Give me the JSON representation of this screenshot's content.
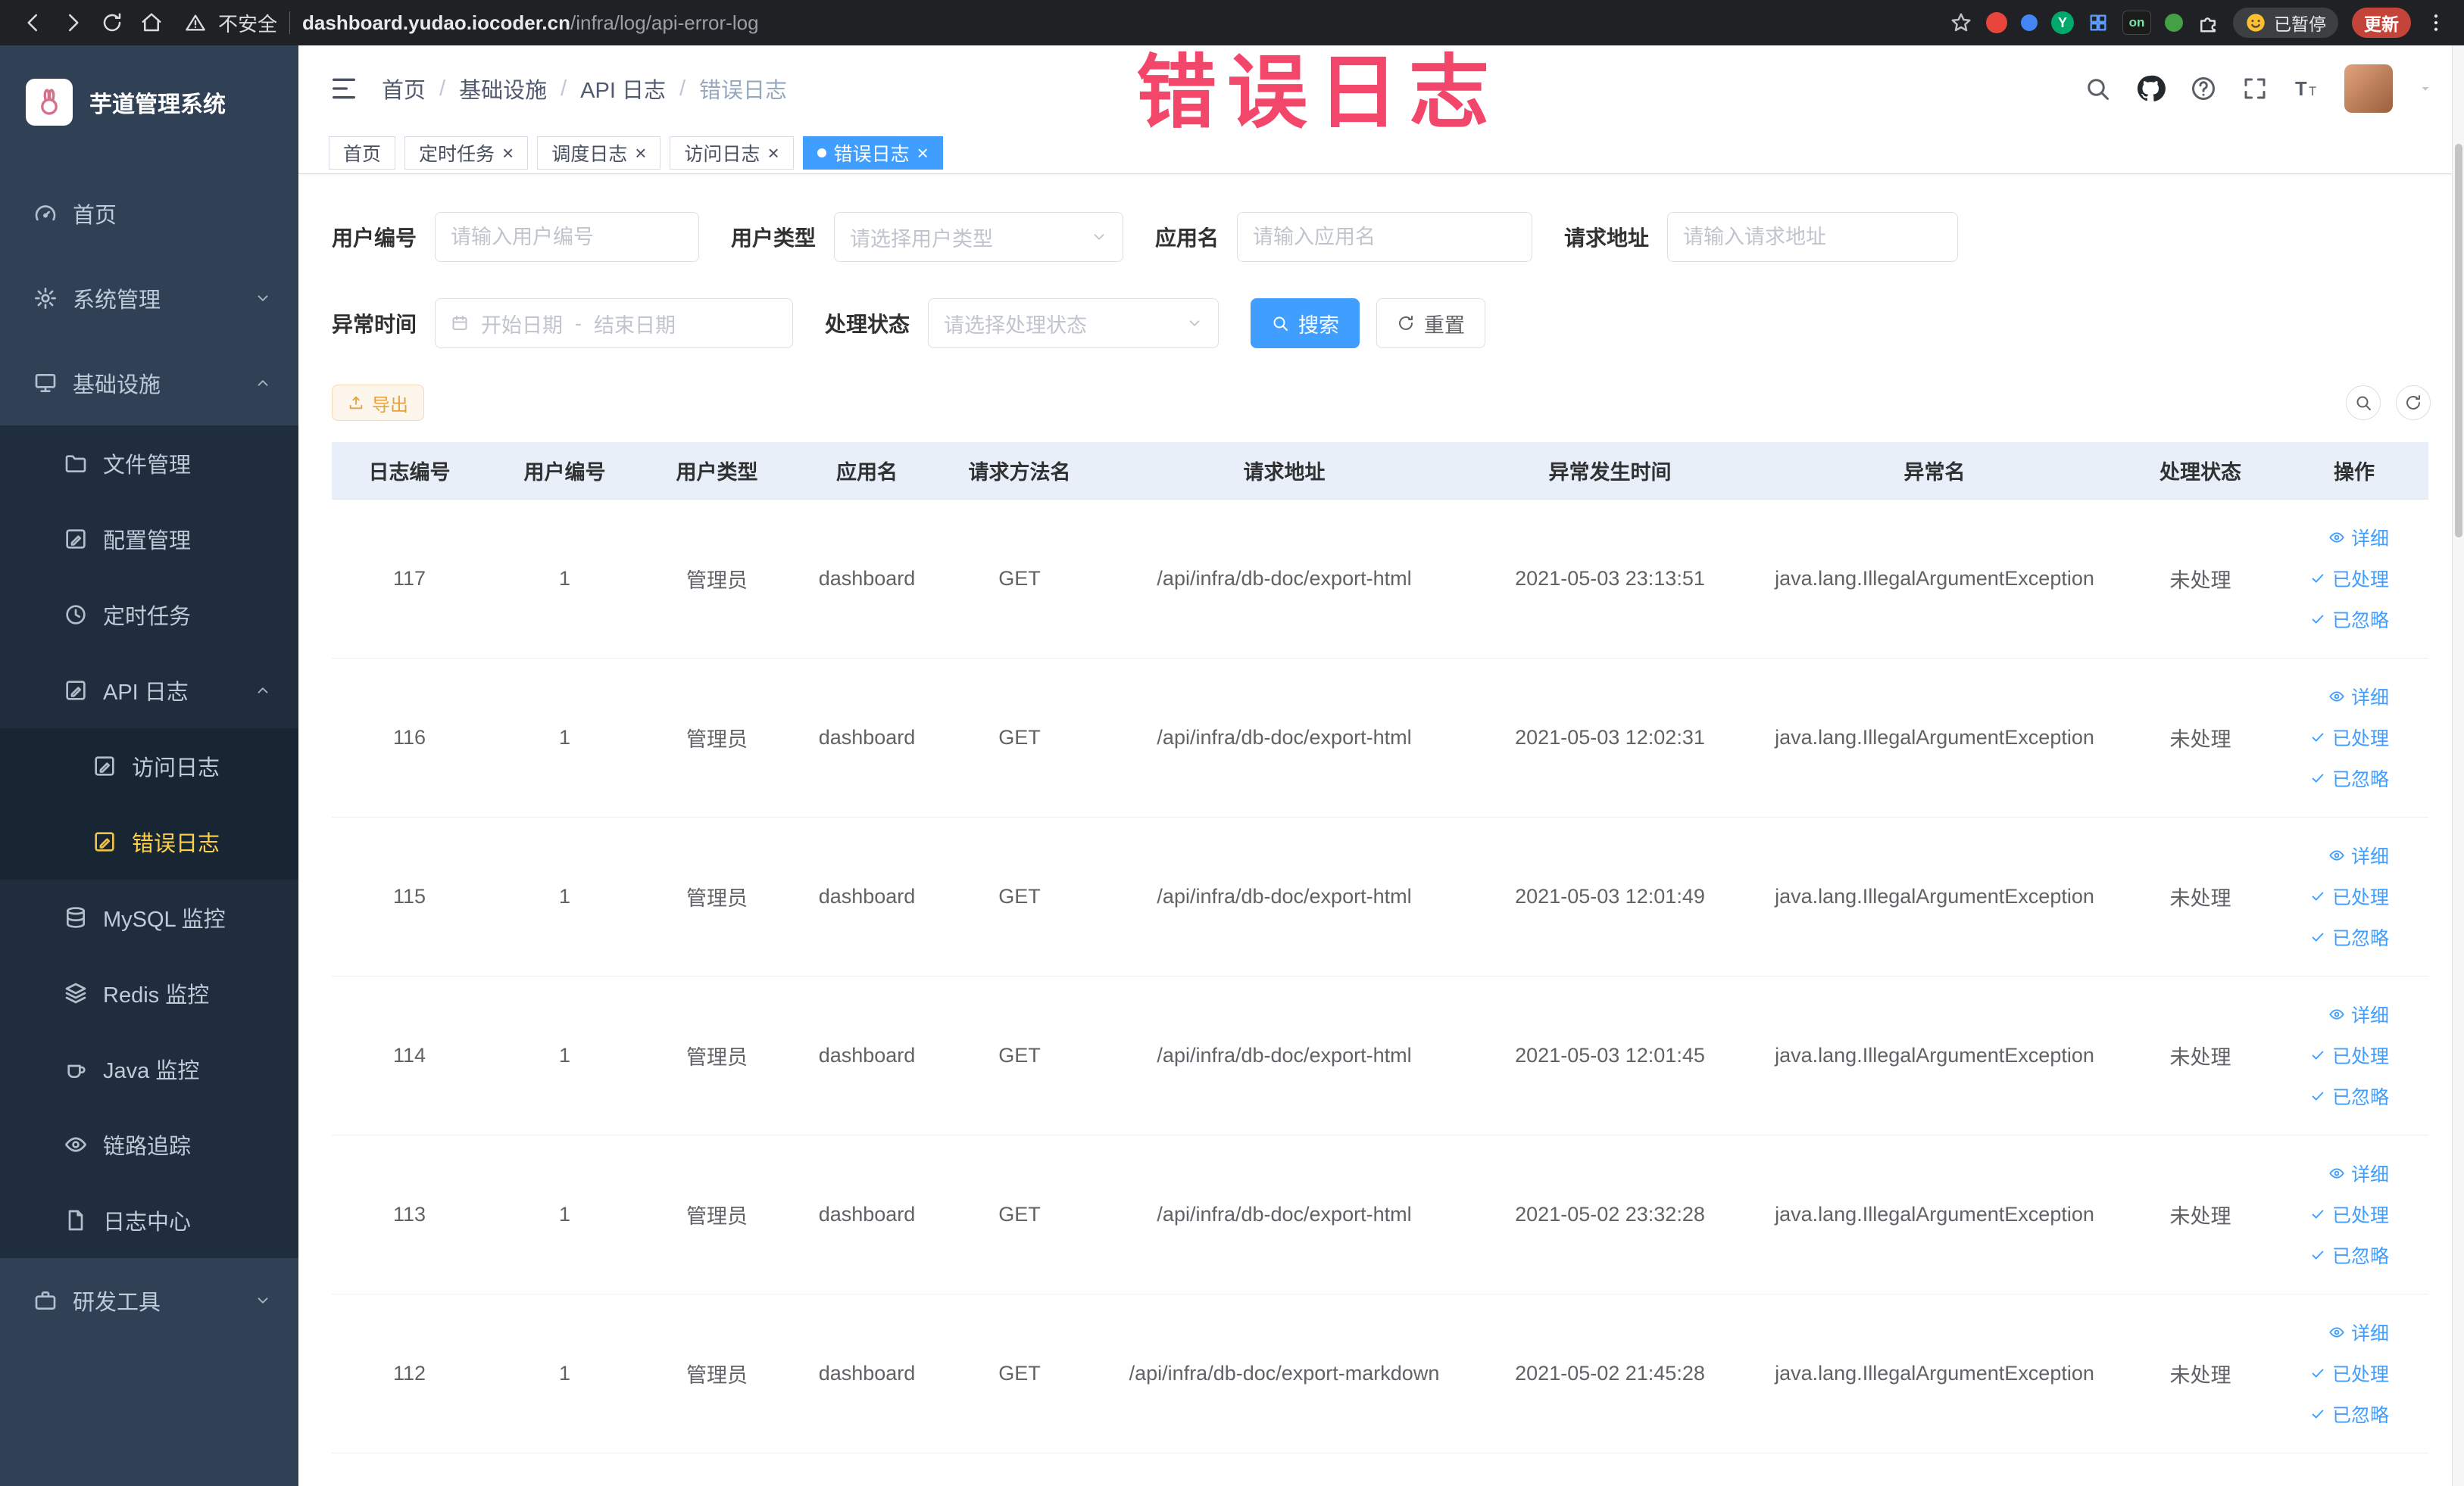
{
  "browser": {
    "security_label": "不安全",
    "url_domain": "dashboard.yudao.iocoder.cn",
    "url_path": "/infra/log/api-error-log",
    "extension_on_badge": "on",
    "paused_label": "已暂停",
    "update_label": "更新"
  },
  "annotation": {
    "text": "错误日志",
    "color": "#f2466b"
  },
  "sidebar": {
    "app_title": "芋道管理系统",
    "items": [
      {
        "key": "home",
        "label": "首页",
        "level": 1,
        "icon": "gauge"
      },
      {
        "key": "system",
        "label": "系统管理",
        "level": 1,
        "icon": "gear",
        "arrow": "down"
      },
      {
        "key": "infra",
        "label": "基础设施",
        "level": 1,
        "icon": "infra",
        "arrow": "up"
      },
      {
        "key": "file",
        "label": "文件管理",
        "level": 2,
        "icon": "folder"
      },
      {
        "key": "config",
        "label": "配置管理",
        "level": 2,
        "icon": "edit"
      },
      {
        "key": "job",
        "label": "定时任务",
        "level": 2,
        "icon": "clock"
      },
      {
        "key": "api-log",
        "label": "API 日志",
        "level": 2,
        "icon": "edit",
        "arrow": "up"
      },
      {
        "key": "access-log",
        "label": "访问日志",
        "level": 3,
        "icon": "edit"
      },
      {
        "key": "error-log",
        "label": "错误日志",
        "level": 3,
        "icon": "edit",
        "active": true
      },
      {
        "key": "mysql",
        "label": "MySQL 监控",
        "level": 2,
        "icon": "db"
      },
      {
        "key": "redis",
        "label": "Redis 监控",
        "level": 2,
        "icon": "layers"
      },
      {
        "key": "java",
        "label": "Java 监控",
        "level": 2,
        "icon": "coffee"
      },
      {
        "key": "trace",
        "label": "链路追踪",
        "level": 2,
        "icon": "eye"
      },
      {
        "key": "log-center",
        "label": "日志中心",
        "level": 2,
        "icon": "doc"
      },
      {
        "key": "dev-tools",
        "label": "研发工具",
        "level": 1,
        "icon": "tools",
        "arrow": "down"
      }
    ]
  },
  "header": {
    "breadcrumb": [
      "首页",
      "基础设施",
      "API 日志",
      "错误日志"
    ]
  },
  "tabs": [
    {
      "label": "首页",
      "closable": false,
      "active": false
    },
    {
      "label": "定时任务",
      "closable": true,
      "active": false
    },
    {
      "label": "调度日志",
      "closable": true,
      "active": false
    },
    {
      "label": "访问日志",
      "closable": true,
      "active": false
    },
    {
      "label": "错误日志",
      "closable": true,
      "active": true
    }
  ],
  "filters": {
    "user_id_label": "用户编号",
    "user_id_placeholder": "请输入用户编号",
    "user_type_label": "用户类型",
    "user_type_placeholder": "请选择用户类型",
    "app_name_label": "应用名",
    "app_name_placeholder": "请输入应用名",
    "request_url_label": "请求地址",
    "request_url_placeholder": "请输入请求地址",
    "exception_time_label": "异常时间",
    "start_placeholder": "开始日期",
    "range_separator": "-",
    "end_placeholder": "结束日期",
    "process_status_label": "处理状态",
    "process_status_placeholder": "请选择处理状态",
    "search_label": "搜索",
    "reset_label": "重置"
  },
  "toolbar": {
    "export_label": "导出"
  },
  "table": {
    "columns": [
      "日志编号",
      "用户编号",
      "用户类型",
      "应用名",
      "请求方法名",
      "请求地址",
      "异常发生时间",
      "异常名",
      "处理状态",
      "操作"
    ],
    "rows": [
      {
        "id": "117",
        "user_id": "1",
        "user_type": "管理员",
        "app": "dashboard",
        "method": "GET",
        "url": "/api/infra/db-doc/export-html",
        "time": "2021-05-03 23:13:51",
        "exception": "java.lang.IllegalArgumentException",
        "status": "未处理"
      },
      {
        "id": "116",
        "user_id": "1",
        "user_type": "管理员",
        "app": "dashboard",
        "method": "GET",
        "url": "/api/infra/db-doc/export-html",
        "time": "2021-05-03 12:02:31",
        "exception": "java.lang.IllegalArgumentException",
        "status": "未处理"
      },
      {
        "id": "115",
        "user_id": "1",
        "user_type": "管理员",
        "app": "dashboard",
        "method": "GET",
        "url": "/api/infra/db-doc/export-html",
        "time": "2021-05-03 12:01:49",
        "exception": "java.lang.IllegalArgumentException",
        "status": "未处理"
      },
      {
        "id": "114",
        "user_id": "1",
        "user_type": "管理员",
        "app": "dashboard",
        "method": "GET",
        "url": "/api/infra/db-doc/export-html",
        "time": "2021-05-03 12:01:45",
        "exception": "java.lang.IllegalArgumentException",
        "status": "未处理"
      },
      {
        "id": "113",
        "user_id": "1",
        "user_type": "管理员",
        "app": "dashboard",
        "method": "GET",
        "url": "/api/infra/db-doc/export-html",
        "time": "2021-05-02 23:32:28",
        "exception": "java.lang.IllegalArgumentException",
        "status": "未处理"
      },
      {
        "id": "112",
        "user_id": "1",
        "user_type": "管理员",
        "app": "dashboard",
        "method": "GET",
        "url": "/api/infra/db-doc/export-markdown",
        "time": "2021-05-02 21:45:28",
        "exception": "java.lang.IllegalArgumentException",
        "status": "未处理"
      }
    ],
    "actions": [
      {
        "label": "详细",
        "icon": "eye"
      },
      {
        "label": "已处理",
        "icon": "check"
      },
      {
        "label": "已忽略",
        "icon": "check"
      }
    ]
  },
  "colors": {
    "primary": "#409EFF",
    "warning": "#E6A23C",
    "sidebar_active": "#FFD04B",
    "annotation": "#F2466B"
  }
}
